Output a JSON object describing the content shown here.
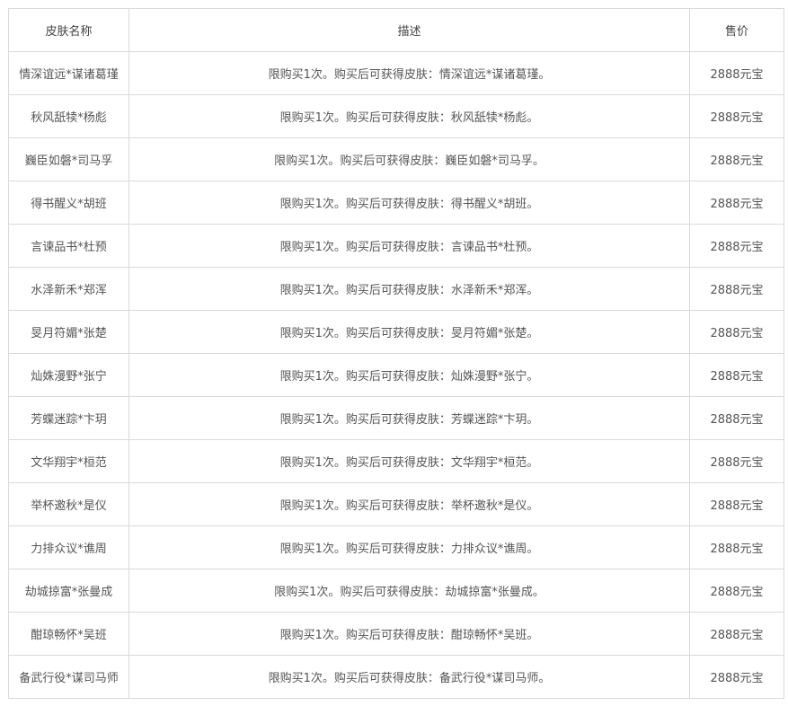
{
  "table": {
    "headers": [
      "皮肤名称",
      "描述",
      "售价"
    ],
    "rows": [
      {
        "name": "情深谊远*谋诸葛瑾",
        "desc": "限购买1次。购买后可获得皮肤：情深谊远*谋诸葛瑾。",
        "price": "2888元宝"
      },
      {
        "name": "秋风舐犊*杨彪",
        "desc": "限购买1次。购买后可获得皮肤：秋风舐犊*杨彪。",
        "price": "2888元宝"
      },
      {
        "name": "巍臣如磐*司马孚",
        "desc": "限购买1次。购买后可获得皮肤：巍臣如磐*司马孚。",
        "price": "2888元宝"
      },
      {
        "name": "得书醒义*胡班",
        "desc": "限购买1次。购买后可获得皮肤：得书醒义*胡班。",
        "price": "2888元宝"
      },
      {
        "name": "言谏品书*杜预",
        "desc": "限购买1次。购买后可获得皮肤：言谏品书*杜预。",
        "price": "2888元宝"
      },
      {
        "name": "水泽新禾*郑浑",
        "desc": "限购买1次。购买后可获得皮肤：水泽新禾*郑浑。",
        "price": "2888元宝"
      },
      {
        "name": "旻月符媚*张楚",
        "desc": "限购买1次。购买后可获得皮肤：旻月符媚*张楚。",
        "price": "2888元宝"
      },
      {
        "name": "灿姝漫野*张宁",
        "desc": "限购买1次。购买后可获得皮肤：灿姝漫野*张宁。",
        "price": "2888元宝"
      },
      {
        "name": "芳蝶迷踪*卞玥",
        "desc": "限购买1次。购买后可获得皮肤：芳蝶迷踪*卞玥。",
        "price": "2888元宝"
      },
      {
        "name": "文华翔宇*桓范",
        "desc": "限购买1次。购买后可获得皮肤：文华翔宇*桓范。",
        "price": "2888元宝"
      },
      {
        "name": "举杯邀秋*是仪",
        "desc": "限购买1次。购买后可获得皮肤：举杯邀秋*是仪。",
        "price": "2888元宝"
      },
      {
        "name": "力排众议*谯周",
        "desc": "限购买1次。购买后可获得皮肤：力排众议*谯周。",
        "price": "2888元宝"
      },
      {
        "name": "劫城掠富*张曼成",
        "desc": "限购买1次。购买后可获得皮肤：劫城掠富*张曼成。",
        "price": "2888元宝"
      },
      {
        "name": "酣琼畅怀*吴班",
        "desc": "限购买1次。购买后可获得皮肤：酣琼畅怀*吴班。",
        "price": "2888元宝"
      },
      {
        "name": "备武行役*谋司马师",
        "desc": "限购买1次。购买后可获得皮肤：备武行役*谋司马师。",
        "price": "2888元宝"
      }
    ]
  },
  "colors": {
    "border": "#d9d9d9",
    "text": "#555555",
    "background": "#ffffff"
  }
}
